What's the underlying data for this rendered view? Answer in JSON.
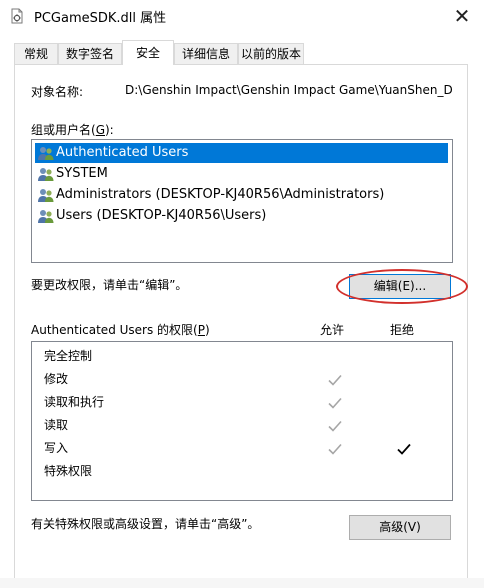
{
  "window": {
    "title": "PCGameSDK.dll 属性",
    "close_glyph": "✕"
  },
  "tabs": [
    {
      "label": "常规",
      "active": false
    },
    {
      "label": "数字签名",
      "active": false
    },
    {
      "label": "安全",
      "active": true
    },
    {
      "label": "详细信息",
      "active": false
    },
    {
      "label": "以前的版本",
      "active": false
    }
  ],
  "security": {
    "object_name_label": "对象名称:",
    "object_name_value": "D:\\Genshin Impact\\Genshin Impact Game\\YuanShen_Data",
    "group_label_prefix": "组或用户名(",
    "group_label_key": "G",
    "group_label_suffix": "):",
    "users": [
      {
        "label": "Authenticated Users",
        "selected": true,
        "icon": "users-group-icon"
      },
      {
        "label": "SYSTEM",
        "selected": false,
        "icon": "users-group-icon"
      },
      {
        "label": "Administrators (DESKTOP-KJ40R56\\Administrators)",
        "selected": false,
        "icon": "users-group-icon"
      },
      {
        "label": "Users (DESKTOP-KJ40R56\\Users)",
        "selected": false,
        "icon": "users-group-icon"
      }
    ],
    "change_hint": "要更改权限，请单击“编辑”。",
    "edit_button": "编辑(E)...",
    "perm_label_prefix": "Authenticated Users 的权限(",
    "perm_label_key": "P",
    "perm_label_suffix": ")",
    "allow_header": "允许",
    "deny_header": "拒绝",
    "permissions": [
      {
        "name": "完全控制",
        "allow": false,
        "deny": false
      },
      {
        "name": "修改",
        "allow": "inherited",
        "deny": false
      },
      {
        "name": "读取和执行",
        "allow": "inherited",
        "deny": false
      },
      {
        "name": "读取",
        "allow": "inherited",
        "deny": false
      },
      {
        "name": "写入",
        "allow": "inherited",
        "deny": true
      },
      {
        "name": "特殊权限",
        "allow": false,
        "deny": false
      }
    ],
    "advanced_hint": "有关特殊权限或高级设置，请单击“高级”。",
    "advanced_button": "高级(V)"
  },
  "colors": {
    "selection": "#0078d7",
    "annotation": "#d2302c",
    "inherited_check": "#a6a6a6",
    "explicit_check": "#000000"
  }
}
